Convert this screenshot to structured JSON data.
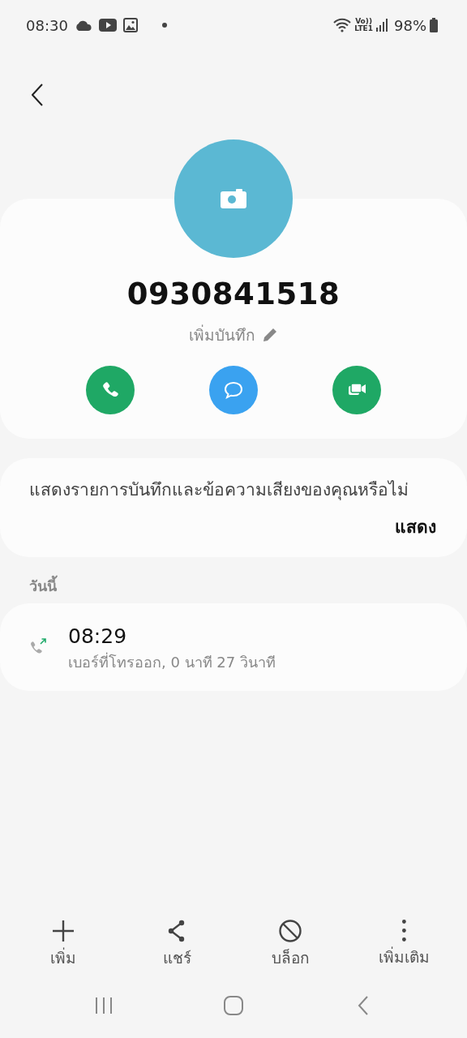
{
  "status_bar": {
    "time": "08:30",
    "volte": "Vo))",
    "network": "LTE1",
    "battery": "98%"
  },
  "contact": {
    "number": "0930841518",
    "note_label": "เพิ่มบันทึก"
  },
  "actions": [
    {
      "kind": "call",
      "color": "#1fa865"
    },
    {
      "kind": "message",
      "color": "#3aa2f0"
    },
    {
      "kind": "video",
      "color": "#1fa865"
    }
  ],
  "prompt": {
    "text": "แสดงรายการบันทึกและข้อความเสียงของคุณหรือไม่",
    "button": "แสดง"
  },
  "section_label": "วันนี้",
  "calls": [
    {
      "kind": "outgoing",
      "time": "08:29",
      "detail": "เบอร์ที่โทรออก, 0 นาที 27 วินาที"
    }
  ],
  "bottom_actions": [
    {
      "kind": "add",
      "label": "เพิ่ม"
    },
    {
      "kind": "share",
      "label": "แชร์"
    },
    {
      "kind": "block",
      "label": "บล็อก"
    },
    {
      "kind": "more",
      "label": "เพิ่มเติม"
    }
  ]
}
